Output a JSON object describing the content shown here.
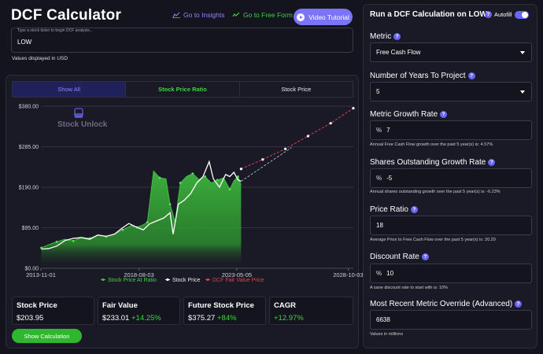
{
  "header": {
    "title": "DCF Calculator",
    "link_insights": "Go to Insights",
    "link_free": "Go to Free Form",
    "video_label": "Video Tutorial"
  },
  "ticker": {
    "placeholder": "Type a stock ticker to begin DCF analysis...",
    "value": "LOW"
  },
  "units_note": "Values displayed in USD",
  "tabs": [
    "Show All",
    "Stock Price Ratio",
    "Stock Price"
  ],
  "chart_data": {
    "type": "line",
    "y_ticks": [
      "$0.00",
      "$95.00",
      "$190.00",
      "$285.00",
      "$380.00"
    ],
    "ylim": [
      0,
      380
    ],
    "x_ticks": [
      "2013-11-01",
      "2018-08-03",
      "2023-05-05",
      "2028-10-03"
    ],
    "watermark": "Stock Unlock",
    "legend": [
      "Stock Price At Ratio",
      "Stock Price",
      "DCF Fair Value Price"
    ],
    "series": [
      {
        "name": "Stock Price At Ratio",
        "color": "#3fbf3f",
        "points": [
          [
            2013.85,
            48
          ],
          [
            2014.2,
            55
          ],
          [
            2014.6,
            62
          ],
          [
            2015.0,
            68
          ],
          [
            2015.4,
            64
          ],
          [
            2015.8,
            72
          ],
          [
            2016.2,
            70
          ],
          [
            2016.6,
            78
          ],
          [
            2017.0,
            74
          ],
          [
            2017.4,
            80
          ],
          [
            2017.8,
            90
          ],
          [
            2018.2,
            100
          ],
          [
            2018.5,
            96
          ],
          [
            2018.8,
            102
          ],
          [
            2019.0,
            108
          ],
          [
            2019.3,
            228
          ],
          [
            2019.6,
            212
          ],
          [
            2019.9,
            210
          ],
          [
            2020.1,
            150
          ],
          [
            2020.35,
            108
          ],
          [
            2020.6,
            200
          ],
          [
            2020.9,
            215
          ],
          [
            2021.2,
            222
          ],
          [
            2021.5,
            208
          ],
          [
            2021.8,
            215
          ],
          [
            2022.1,
            200
          ],
          [
            2022.4,
            207
          ],
          [
            2022.7,
            212
          ],
          [
            2023.0,
            185
          ],
          [
            2023.2,
            205
          ],
          [
            2023.4,
            215
          ],
          [
            2023.55,
            195
          ]
        ]
      },
      {
        "name": "Stock Price",
        "color": "#ffffff",
        "points": [
          [
            2013.85,
            45
          ],
          [
            2014.2,
            46
          ],
          [
            2014.6,
            52
          ],
          [
            2015.0,
            65
          ],
          [
            2015.4,
            70
          ],
          [
            2015.8,
            72
          ],
          [
            2016.2,
            68
          ],
          [
            2016.6,
            78
          ],
          [
            2017.0,
            75
          ],
          [
            2017.4,
            80
          ],
          [
            2017.8,
            95
          ],
          [
            2018.1,
            105
          ],
          [
            2018.4,
            98
          ],
          [
            2018.8,
            90
          ],
          [
            2019.1,
            104
          ],
          [
            2019.4,
            110
          ],
          [
            2019.8,
            118
          ],
          [
            2020.1,
            130
          ],
          [
            2020.25,
            80
          ],
          [
            2020.5,
            150
          ],
          [
            2020.8,
            160
          ],
          [
            2021.1,
            175
          ],
          [
            2021.4,
            200
          ],
          [
            2021.7,
            215
          ],
          [
            2022.0,
            250
          ],
          [
            2022.2,
            210
          ],
          [
            2022.5,
            190
          ],
          [
            2022.8,
            220
          ],
          [
            2023.0,
            215
          ],
          [
            2023.2,
            225
          ],
          [
            2023.4,
            207
          ],
          [
            2023.55,
            204
          ]
        ]
      },
      {
        "name": "DCF Fair Value Price",
        "color": "#e0404a",
        "points": [
          [
            2023.55,
            233
          ],
          [
            2024.6,
            255
          ],
          [
            2025.7,
            280
          ],
          [
            2026.8,
            310
          ],
          [
            2027.9,
            340
          ],
          [
            2029.0,
            375.27
          ]
        ]
      }
    ]
  },
  "metrics": [
    {
      "label": "Stock Price",
      "value": "$203.95",
      "pct": ""
    },
    {
      "label": "Fair Value",
      "value": "$233.01",
      "pct": "+14.25%"
    },
    {
      "label": "Future Stock Price",
      "value": "$375.27",
      "pct": "+84%"
    },
    {
      "label": "CAGR",
      "value": "",
      "pct": "+12.97%"
    }
  ],
  "show_calc": "Show Calculation",
  "side": {
    "title": "Run a DCF Calculation on LOW",
    "autofill": "Autofill",
    "metric_label": "Metric",
    "metric_value": "Free Cash Flow",
    "years_label": "Number of Years To Project",
    "years_value": "5",
    "growth_label": "Metric Growth Rate",
    "growth_value": "7",
    "growth_hint": "Annual Free Cash Flow growth over the past 5 year(s) is: 4.57%",
    "shares_label": "Shares Outstanding Growth Rate",
    "shares_value": "-5",
    "shares_hint": "Annual shares outstanding growth over the past 5 year(s) is: -6.23%",
    "ratio_label": "Price Ratio",
    "ratio_value": "18",
    "ratio_hint": "Average Price to Free Cash Flow over the past 5 year(s) is: 20.20",
    "discount_label": "Discount Rate",
    "discount_value": "10",
    "discount_hint": "A sane discount rate to start with is: 10%",
    "override_label": "Most Recent Metric Override (Advanced)",
    "override_value": "6638",
    "override_hint": "Values in millions",
    "pct_symbol": "%"
  }
}
